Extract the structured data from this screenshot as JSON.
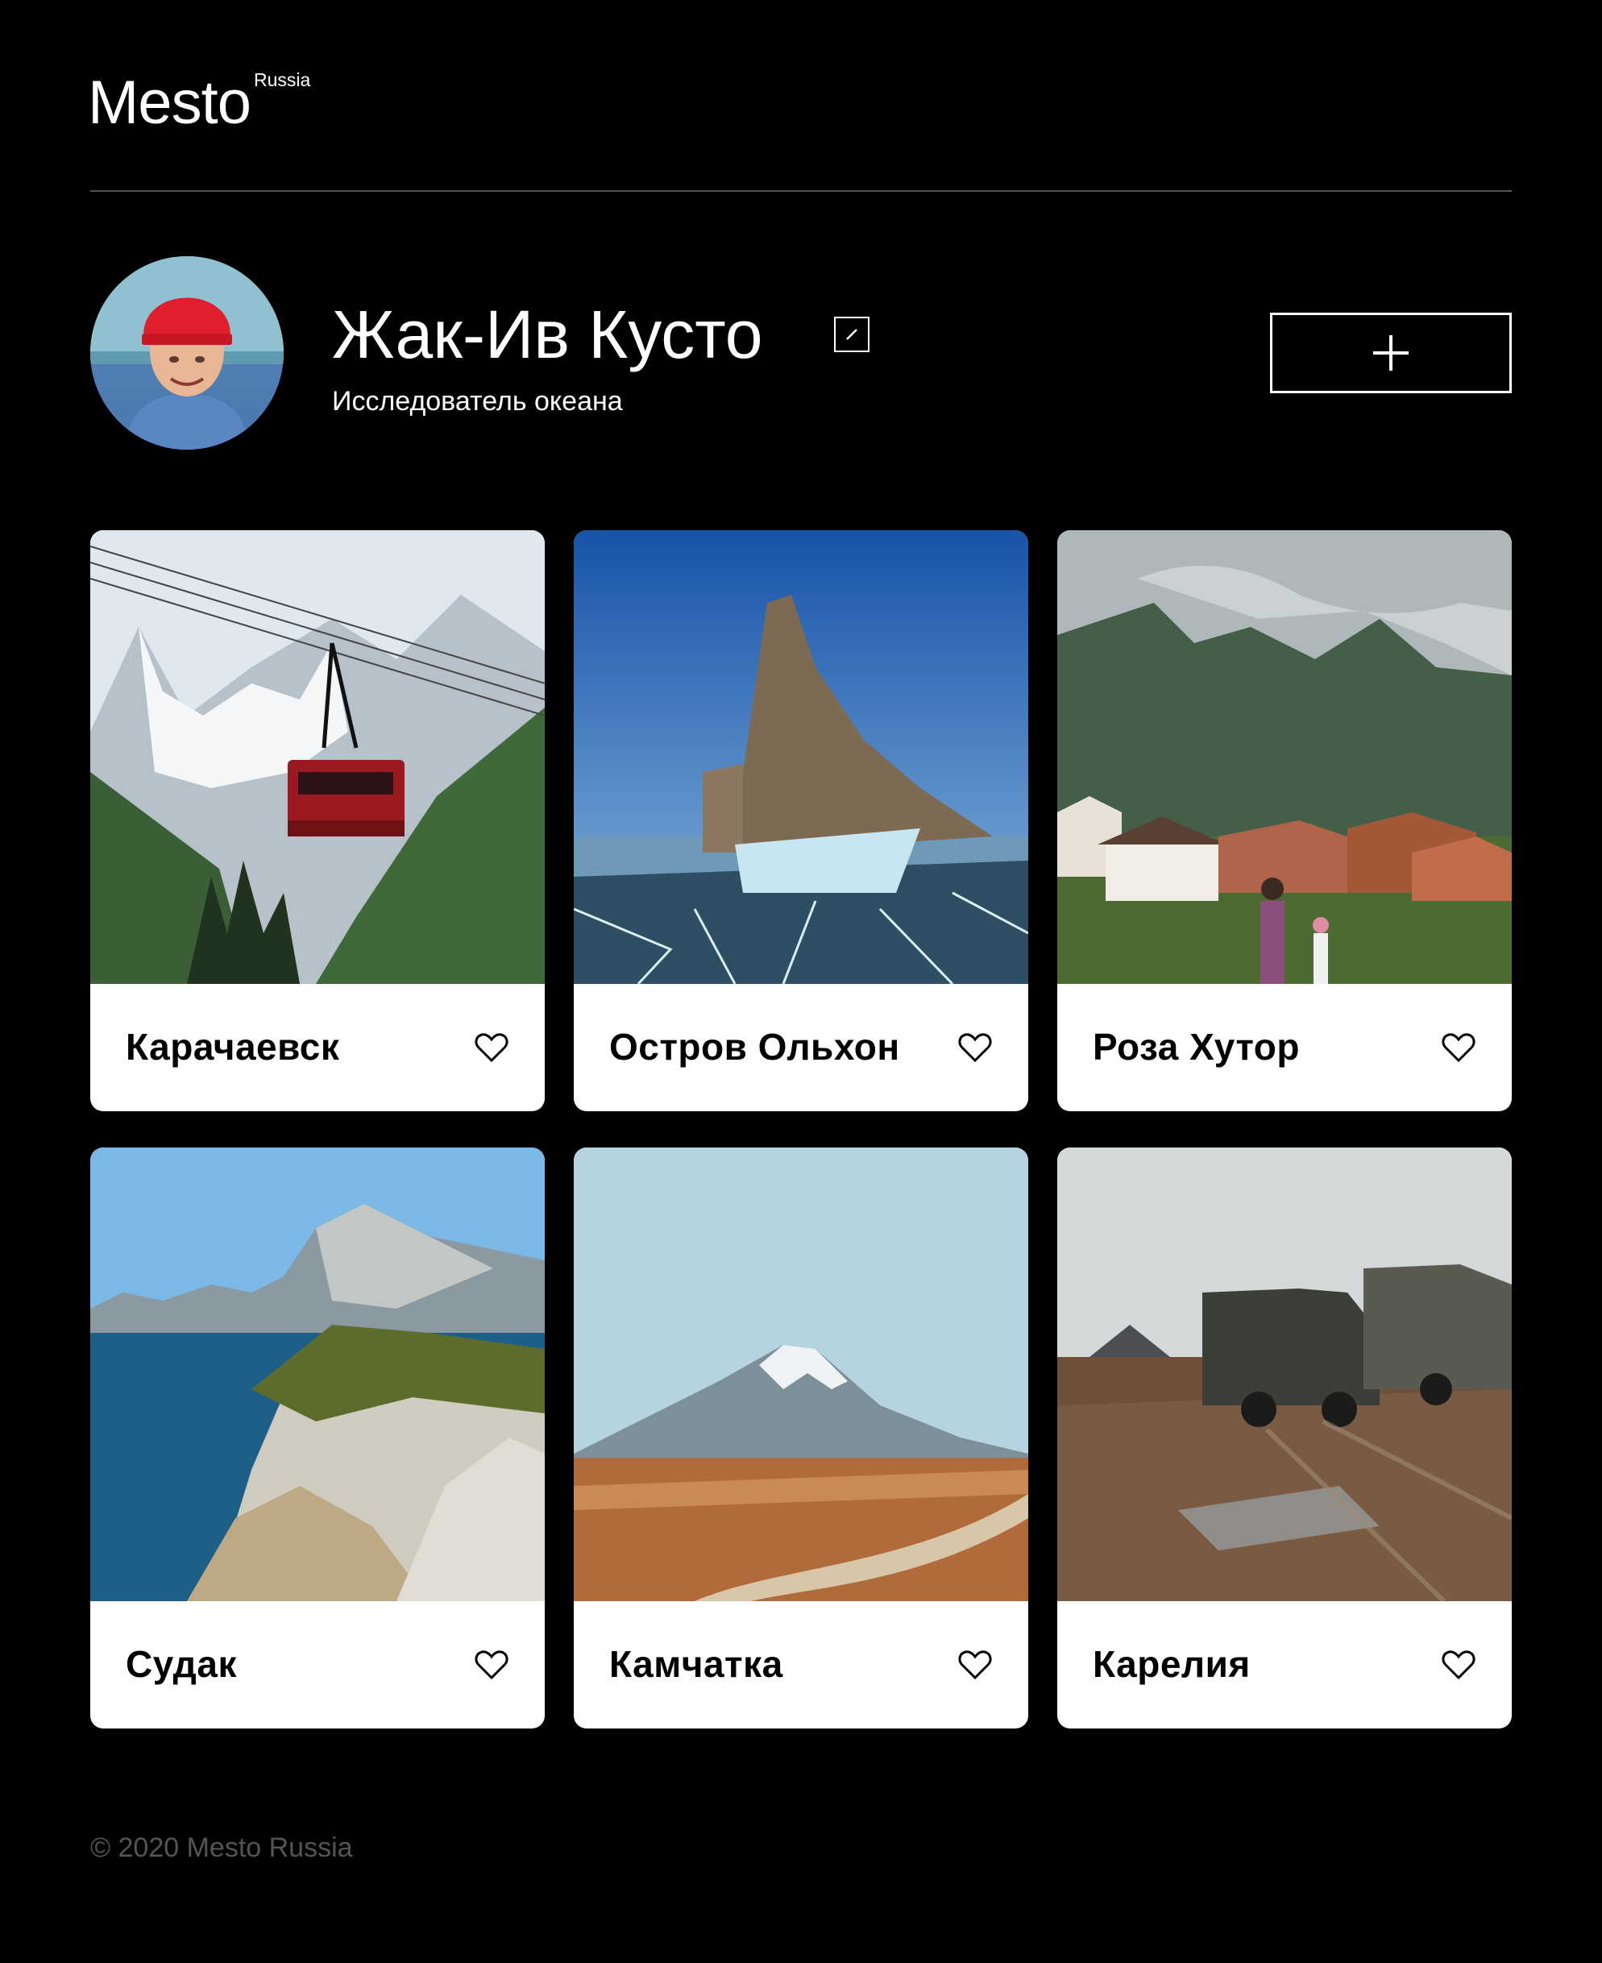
{
  "header": {
    "logo": "Mesto",
    "logo_sup": "Russia",
    "logo_icon": "mesto-logo"
  },
  "profile": {
    "name": "Жак-Ив Кусто",
    "about": "Исследователь океана",
    "edit_icon": "pencil-icon",
    "add_icon": "plus-icon"
  },
  "cards": [
    {
      "title": "Карачаевск",
      "image": "cable-car-mountains",
      "like_icon": "heart-outline-icon"
    },
    {
      "title": "Остров Ольхон",
      "image": "ice-rock-lake",
      "like_icon": "heart-outline-icon"
    },
    {
      "title": "Роза Хутор",
      "image": "mountain-village",
      "like_icon": "heart-outline-icon"
    },
    {
      "title": "Судак",
      "image": "sea-cliffs",
      "like_icon": "heart-outline-icon"
    },
    {
      "title": "Камчатка",
      "image": "volcano-road",
      "like_icon": "heart-outline-icon"
    },
    {
      "title": "Карелия",
      "image": "trucks-mud",
      "like_icon": "heart-outline-icon"
    }
  ],
  "footer": {
    "copyright": "© 2020 Mesto Russia"
  },
  "colors": {
    "background": "#000000",
    "card": "#ffffff",
    "footer_text": "#545454",
    "divider": "#545454"
  }
}
